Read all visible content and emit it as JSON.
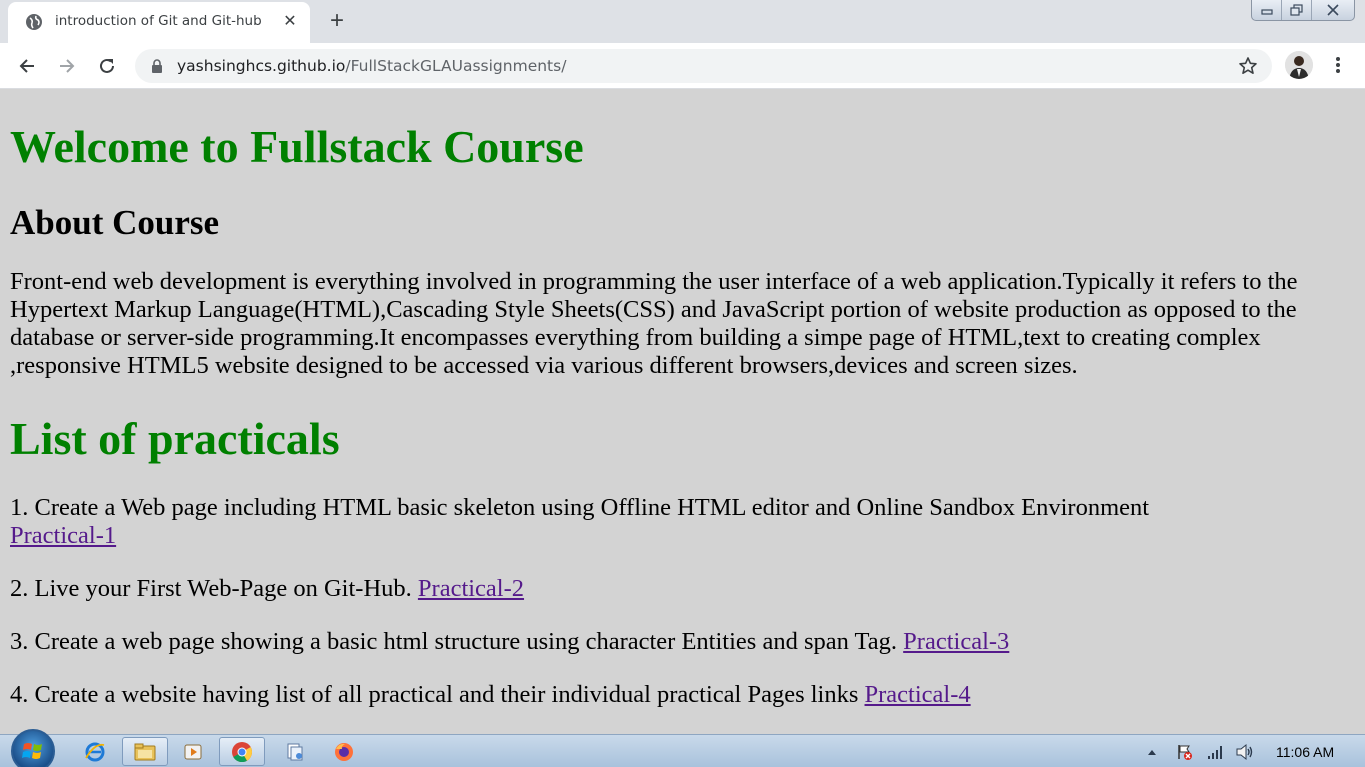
{
  "browser": {
    "tab_title": "introduction of Git and Git-hub",
    "url_host": "yashsinghcs.github.io",
    "url_path": "/FullStackGLAUassignments/"
  },
  "page": {
    "heading": "Welcome to Fullstack Course",
    "about_heading": "About Course",
    "about_text": "Front-end web development is everything involved in programming the user interface of a web application.Typically it refers to the Hypertext Markup Language(HTML),Cascading Style Sheets(CSS) and JavaScript portion of website production as opposed to the database or server-side programming.It encompasses everything from building a simpe page of HTML,text to creating complex ,responsive HTML5 website designed to be accessed via various different browsers,devices and screen sizes.",
    "list_heading": "List of practicals",
    "practicals": [
      {
        "text": "1. Create a Web page including HTML basic skeleton using Offline HTML editor and Online Sandbox Environment",
        "link": "Practical-1"
      },
      {
        "text": "2. Live your First Web-Page on Git-Hub.",
        "link": "Practical-2"
      },
      {
        "text": "3. Create a web page showing a basic html structure using character Entities and span Tag.",
        "link": "Practical-3"
      },
      {
        "text": "4. Create a website having list of all practical and their individual practical Pages links",
        "link": "Practical-4"
      }
    ]
  },
  "taskbar": {
    "clock": "11:06 AM"
  },
  "colors": {
    "heading_green": "#008000",
    "page_bg": "#d3d3d3",
    "visited_link": "#551a8b"
  }
}
